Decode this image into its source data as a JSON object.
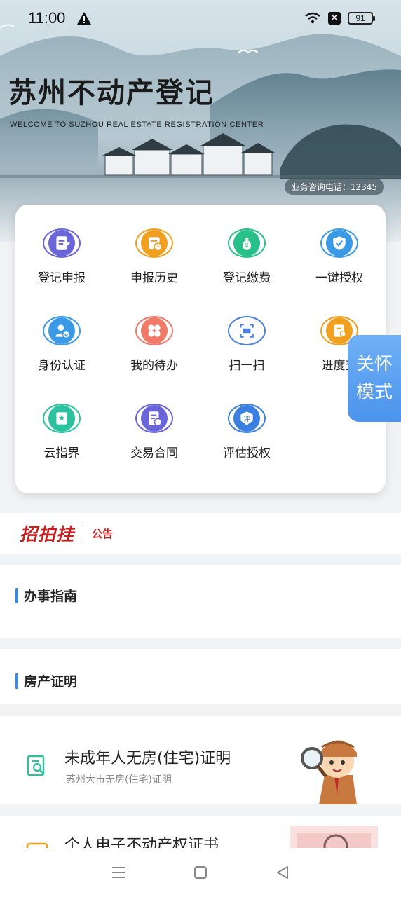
{
  "status_bar": {
    "time": "11:00",
    "battery": "91"
  },
  "header": {
    "title": "苏州不动产登记",
    "subtitle": "WELCOME TO SUZHOU REAL ESTATE REGISTRATION CENTER",
    "hotline": "业务咨询电话：12345"
  },
  "services": [
    {
      "label": "登记申报",
      "icon": "document-edit-icon",
      "color": "#6a66d9"
    },
    {
      "label": "申报历史",
      "icon": "history-icon",
      "color": "#f0a01e"
    },
    {
      "label": "登记缴费",
      "icon": "money-bag-icon",
      "color": "#27c08a"
    },
    {
      "label": "一键授权",
      "icon": "shield-check-icon",
      "color": "#3b9ae6"
    },
    {
      "label": "身份认证",
      "icon": "user-verify-icon",
      "color": "#3b9ae6"
    },
    {
      "label": "我的待办",
      "icon": "grid-todo-icon",
      "color": "#f07a6a"
    },
    {
      "label": "扫一扫",
      "icon": "scan-icon",
      "color": "#4a7fe0"
    },
    {
      "label": "进度查",
      "icon": "progress-search-icon",
      "color": "#f0a01e"
    },
    {
      "label": "云指界",
      "icon": "book-star-icon",
      "color": "#2cc2a0"
    },
    {
      "label": "交易合同",
      "icon": "contract-icon",
      "color": "#6a66d9"
    },
    {
      "label": "评估授权",
      "icon": "evaluate-icon",
      "color": "#3b7fe0"
    }
  ],
  "care_mode": {
    "line1": "关怀",
    "line2": "模式"
  },
  "notice": {
    "logo": "招拍挂",
    "tag": "公告"
  },
  "sections": {
    "guide_title": "办事指南",
    "cert_title": "房产证明"
  },
  "cert_items": [
    {
      "title": "未成年人无房(住宅)证明",
      "subtitle": "苏州大市无房(住宅)证明"
    },
    {
      "title": "个人电子不动产权证书",
      "subtitle": ""
    }
  ]
}
